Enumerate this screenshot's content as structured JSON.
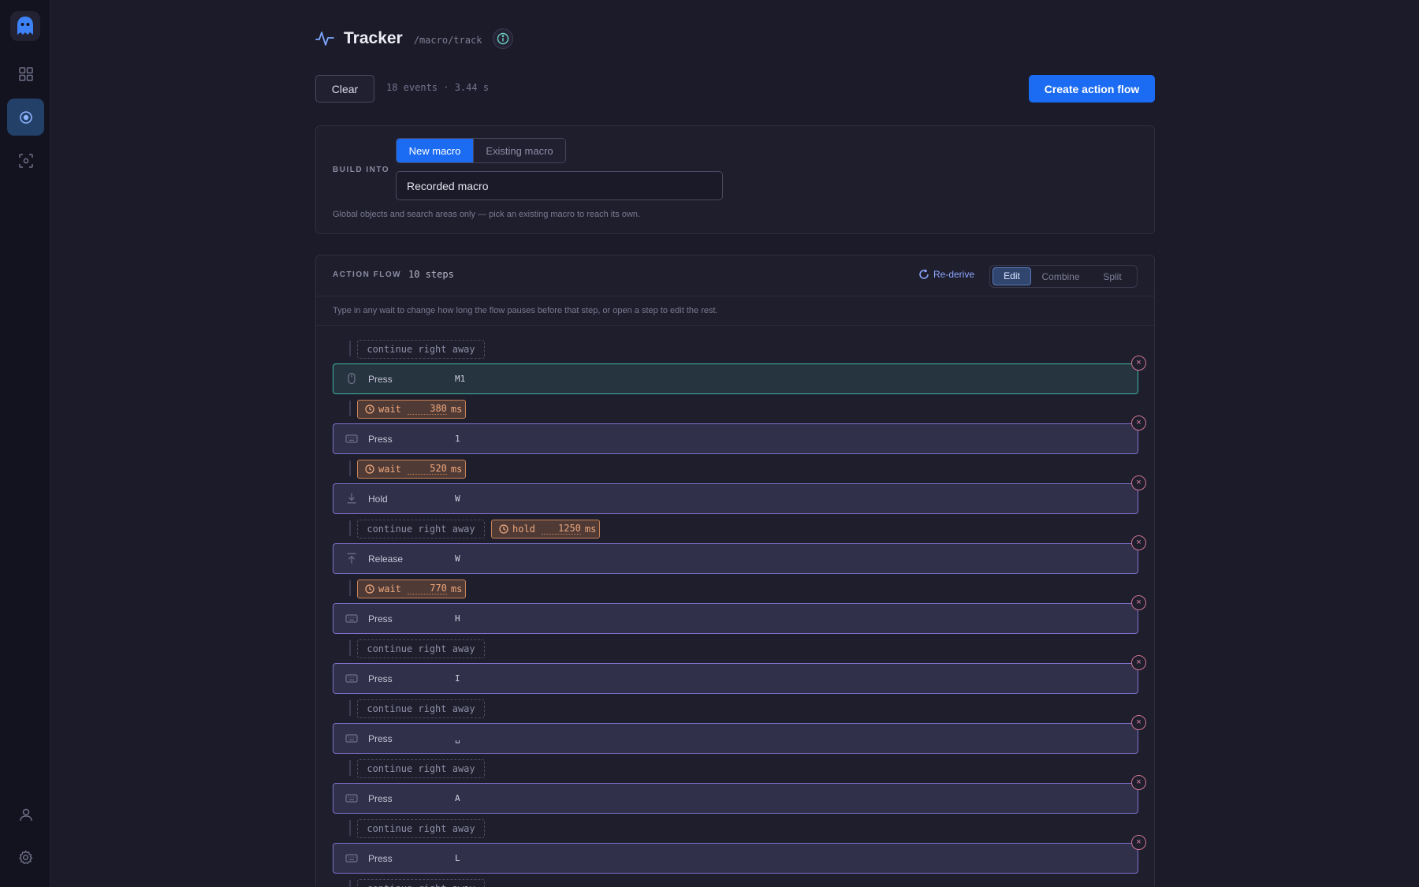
{
  "sidebar": {
    "icons": [
      "ghost-logo",
      "grid-icon",
      "target-icon",
      "scan-icon",
      "user-icon",
      "gear-icon"
    ]
  },
  "header": {
    "title": "Tracker",
    "route": "/macro/track"
  },
  "toolbar": {
    "clear_label": "Clear",
    "events_summary": "18 events · 3.44 s",
    "create_label": "Create action flow"
  },
  "build": {
    "label": "BUILD INTO",
    "options": [
      "New macro",
      "Existing macro"
    ],
    "selected": "New macro",
    "name_value": "Recorded macro",
    "hint": "Global objects and search areas only — pick an existing macro to reach its own."
  },
  "flow": {
    "label": "ACTION FLOW",
    "steps_count": "10 steps",
    "rederive_label": "Re-derive",
    "modes": [
      "Edit",
      "Combine",
      "Split"
    ],
    "active_mode": "Edit",
    "hint": "Type in any wait to change how long the flow pauses before that step, or open a step to edit the rest.",
    "continue_label": "continue right away",
    "wait_word": "wait",
    "hold_word": "hold",
    "unit": "ms",
    "close_glyph": "×",
    "steps": [
      {
        "type": "Press",
        "key": "M1",
        "icon": "mouse-icon"
      },
      {
        "type": "Press",
        "key": "1",
        "icon": "keyboard-icon"
      },
      {
        "type": "Hold",
        "key": "W",
        "icon": "hold-down-icon"
      },
      {
        "type": "Release",
        "key": "W",
        "icon": "release-up-icon"
      },
      {
        "type": "Press",
        "key": "H",
        "icon": "keyboard-icon"
      },
      {
        "type": "Press",
        "key": "I",
        "icon": "keyboard-icon"
      },
      {
        "type": "Press",
        "key": "␣",
        "icon": "keyboard-icon"
      },
      {
        "type": "Press",
        "key": "A",
        "icon": "keyboard-icon"
      },
      {
        "type": "Press",
        "key": "L",
        "icon": "keyboard-icon"
      }
    ],
    "gaps": [
      {
        "kind": "continue"
      },
      {
        "kind": "wait",
        "value": "380"
      },
      {
        "kind": "wait",
        "value": "520"
      },
      {
        "kind": "continue_hold",
        "value": "1250"
      },
      {
        "kind": "wait",
        "value": "770"
      },
      {
        "kind": "continue"
      },
      {
        "kind": "continue"
      },
      {
        "kind": "continue"
      },
      {
        "kind": "continue"
      },
      {
        "kind": "continue"
      }
    ]
  },
  "colors": {
    "accent": "#1b6cf2",
    "step_border": "#7d72c9",
    "first_step_border": "#3fb6a3",
    "wait_chip": "#c98456",
    "close": "#d07592"
  }
}
